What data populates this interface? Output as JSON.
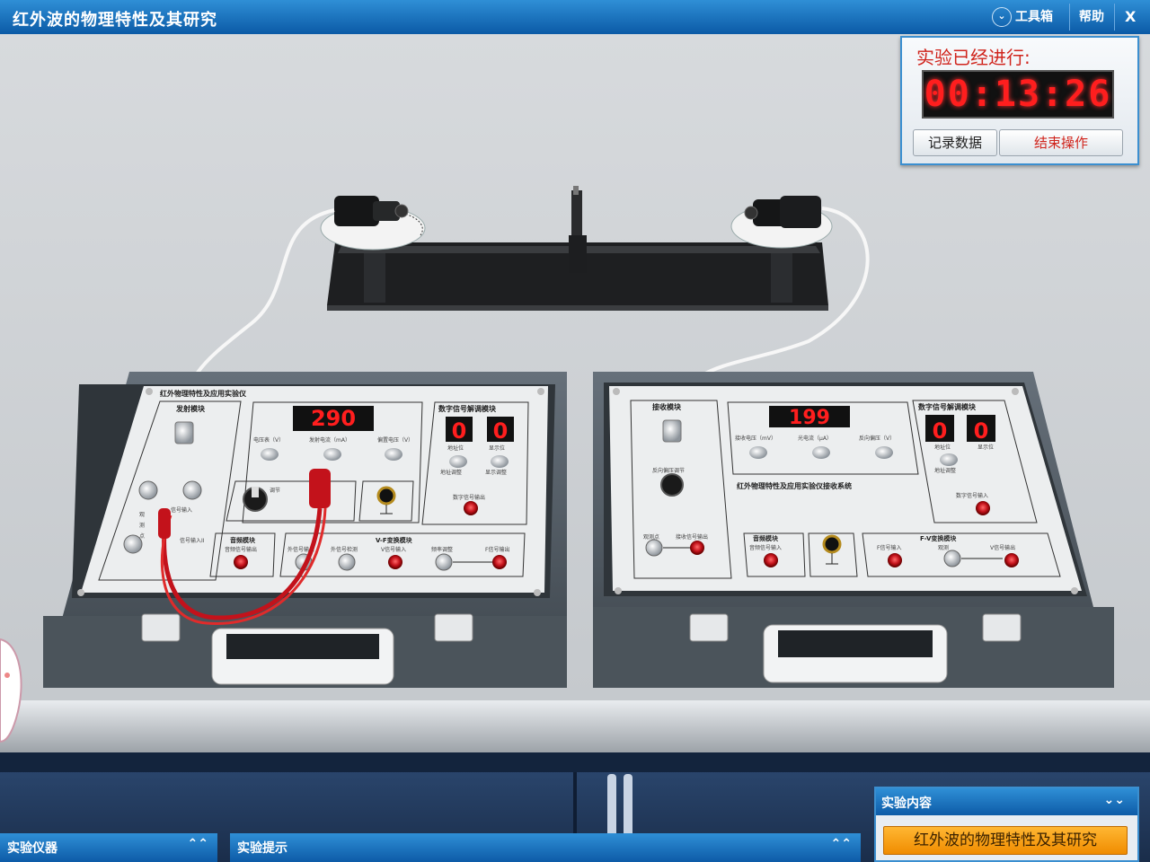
{
  "app": {
    "title": "红外波的物理特性及其研究",
    "toolbox_label": "工具箱",
    "help_label": "帮助",
    "close_label": "X",
    "toolbox_chevron": "⌄"
  },
  "timer": {
    "label": "实验已经进行:",
    "display": "00:13:26",
    "record_button": "记录数据",
    "end_button": "结束操作"
  },
  "panels": {
    "instruments": "实验仪器",
    "hints": "实验提示",
    "content_header": "实验内容",
    "content_item": "红外波的物理特性及其研究",
    "collapse_up": "⌃⌃",
    "collapse_down": "⌄⌄"
  },
  "transmitter_box": {
    "heading": "红外物理特性及应用实验仪",
    "module_emit": "发射模块",
    "display_value": "290",
    "meter_labels": [
      "电压表（V）",
      "发射电流（mA）",
      "偏置电压（V）"
    ],
    "digital_module": "数字信号解调模块",
    "digits": [
      "0",
      "0"
    ],
    "digit_labels": [
      "地址位",
      "显示位"
    ],
    "digit_adjust": [
      "地址调整",
      "显示调整"
    ],
    "digital_output": "数字信号输出",
    "knob_label": "调节",
    "bnc_label": "信号输入",
    "audio_module": "音频模块",
    "audio_output": "音频信号输出",
    "vf_module": "V-F变换模块",
    "vf_labels": [
      "外信号输入",
      "外信号检测",
      "V信号输入",
      "频率调整",
      "F信号输出"
    ],
    "side_labels": [
      "观",
      "测",
      "点"
    ],
    "signal_in2": "信号输入II"
  },
  "receiver_box": {
    "module_recv": "接收模块",
    "display_value": "199",
    "meter_labels": [
      "接收电压（mV）",
      "光电流（μA）",
      "反向偏压（V）"
    ],
    "digital_module": "数字信号解调模块",
    "digits": [
      "0",
      "0"
    ],
    "digit_labels": [
      "地址位",
      "显示位"
    ],
    "digit_adjust": "地址调整",
    "digital_input": "数字信号输入",
    "system_title": "红外物理特性及应用实验仪接收系统",
    "bias_knob": "反向偏压调节",
    "observe": "观测点",
    "recv_output": "接收信号输出",
    "audio_module": "音频模块",
    "audio_input": "音频信号输入",
    "fv_module": "F-V变换模块",
    "fv_labels": [
      "F信号输入",
      "观测",
      "V信号输出"
    ]
  },
  "colors": {
    "titlebar": "#0b5aa6",
    "accent_red": "#d0241c",
    "led_red": "#ff1e1e",
    "case": "#555e63",
    "orange": "#f08c00"
  }
}
